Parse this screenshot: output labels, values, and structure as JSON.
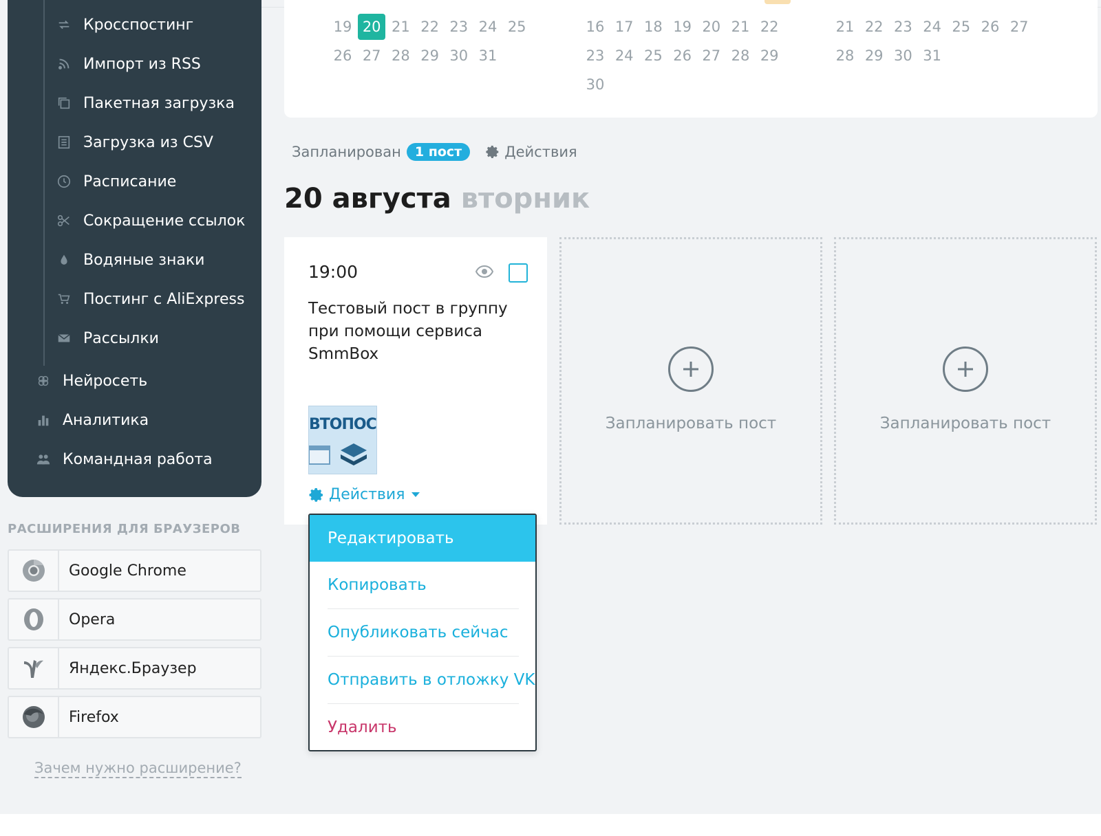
{
  "sidebar": {
    "sub_items": [
      {
        "label": "Кросспостинг",
        "icon": "repost-icon"
      },
      {
        "label": "Импорт из RSS",
        "icon": "rss-icon"
      },
      {
        "label": "Пакетная загрузка",
        "icon": "batch-upload-icon"
      },
      {
        "label": "Загрузка из CSV",
        "icon": "csv-icon"
      },
      {
        "label": "Расписание",
        "icon": "clock-icon"
      },
      {
        "label": "Сокращение ссылок",
        "icon": "scissors-icon"
      },
      {
        "label": "Водяные знаки",
        "icon": "droplet-icon"
      },
      {
        "label": "Постинг с AliExpress",
        "icon": "cart-icon"
      },
      {
        "label": "Рассылки",
        "icon": "envelope-icon"
      }
    ],
    "main_items": [
      {
        "label": "Нейросеть",
        "icon": "brain-icon"
      },
      {
        "label": "Аналитика",
        "icon": "bar-chart-icon"
      },
      {
        "label": "Командная работа",
        "icon": "team-icon"
      }
    ]
  },
  "extensions": {
    "title": "РАСШИРЕНИЯ ДЛЯ БРАУЗЕРОВ",
    "items": [
      {
        "label": "Google Chrome",
        "icon": "chrome-icon"
      },
      {
        "label": "Opera",
        "icon": "opera-icon"
      },
      {
        "label": "Яндекс.Браузер",
        "icon": "yandex-browser-icon"
      },
      {
        "label": "Firefox",
        "icon": "firefox-icon"
      }
    ],
    "why_link": "Зачем нужно расширение?"
  },
  "calendar": {
    "months": [
      {
        "rows": [
          [
            "19",
            "20",
            "21",
            "22",
            "23",
            "24",
            "25"
          ],
          [
            "26",
            "27",
            "28",
            "29",
            "30",
            "31"
          ]
        ]
      },
      {
        "rows": [
          [
            "16",
            "17",
            "18",
            "19",
            "20",
            "21",
            "22"
          ],
          [
            "23",
            "24",
            "25",
            "26",
            "27",
            "28",
            "29"
          ],
          [
            "30"
          ]
        ]
      },
      {
        "rows": [
          [
            "21",
            "22",
            "23",
            "24",
            "25",
            "26",
            "27"
          ],
          [
            "28",
            "29",
            "30",
            "31"
          ]
        ]
      }
    ],
    "selected_day": "20",
    "accent": "#1fb5a0"
  },
  "status": {
    "label": "Запланирован",
    "badge": "1 пост",
    "actions": "Действия"
  },
  "day": {
    "date": "20 августа",
    "weekday": "вторник"
  },
  "post": {
    "time": "19:00",
    "text": "Тестовый пост в группу при помощи сервиса SmmBox",
    "thumb_text": "ВТОПОСТИ",
    "actions_label": "Действия"
  },
  "dropdown": {
    "items": [
      {
        "label": "Редактировать",
        "state": "active"
      },
      {
        "label": "Копировать",
        "state": "normal"
      },
      {
        "label": "Опубликовать сейчас",
        "state": "normal"
      },
      {
        "label": "Отправить в отложку VK",
        "state": "normal"
      },
      {
        "label": "Удалить",
        "state": "danger"
      }
    ]
  },
  "slots": [
    {
      "label": "Запланировать пост"
    },
    {
      "label": "Запланировать пост"
    }
  ],
  "colors": {
    "sidebar_bg": "#2e3e48",
    "link_blue": "#1fa8d6",
    "badge_blue": "#23aede",
    "dropdown_active": "#2cc4ec",
    "danger": "#c8366a"
  }
}
